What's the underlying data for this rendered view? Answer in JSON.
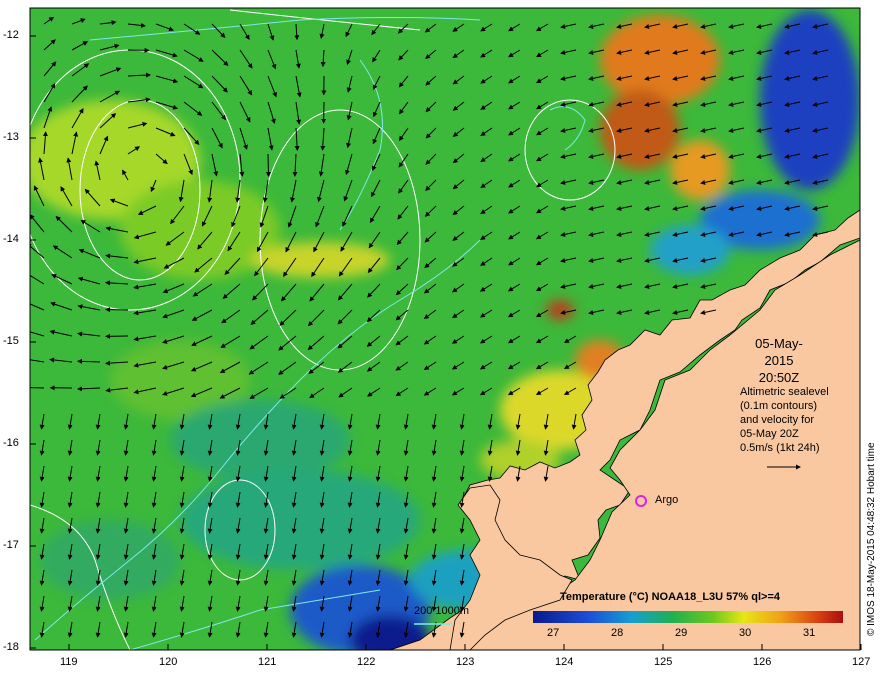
{
  "map": {
    "date": "05-May-2015",
    "time": "20:50Z",
    "altimetry_lines": [
      "Altimetric sealevel",
      "(0.1m contours)",
      "and velocity for",
      "05-May 20Z",
      "0.5m/s (1kt 24h)"
    ],
    "credit": "© IMOS 18-May-2015 04:48:32 Hobart time",
    "colorbar_title": "Temperature (°C) NOAA18_L3U 57% ql>=4",
    "colorbar_ticks": [
      "27",
      "28",
      "29",
      "30",
      "31"
    ],
    "argo_label": "Argo",
    "depth_label": "200  1000m",
    "lon_ticks": [
      "119",
      "120",
      "121",
      "122",
      "123",
      "124",
      "125",
      "126",
      "127"
    ],
    "lat_ticks": [
      "-12",
      "-13",
      "-14",
      "-15",
      "-16",
      "-17",
      "-18"
    ],
    "colors": {
      "land": "#f9c8a0",
      "ocean_green": "#3cb83a",
      "warm_orange": "#e07a1c",
      "cool_blue": "#1e3fc0",
      "contour": "#7fe8e8",
      "argo": "#e020e0"
    }
  }
}
